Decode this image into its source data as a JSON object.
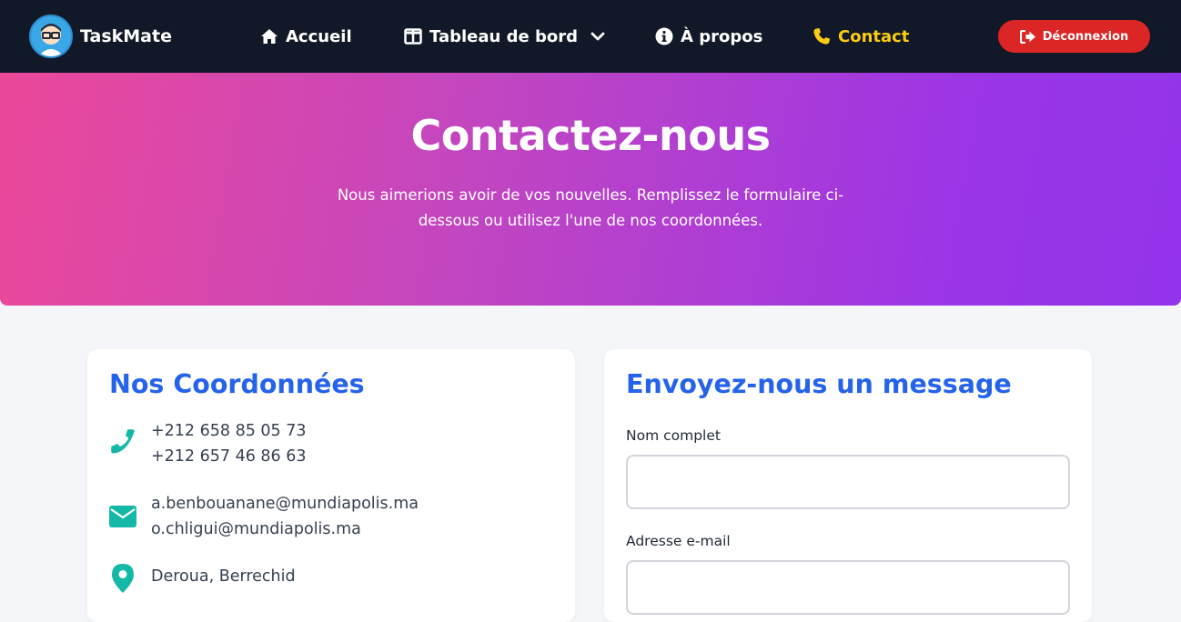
{
  "brand": {
    "name": "TaskMate",
    "logo_icon": "avatar-glasses-icon"
  },
  "nav": {
    "home": "Accueil",
    "dashboard": "Tableau de bord",
    "about": "À propos",
    "contact": "Contact",
    "logout": "Déconnexion",
    "active_color": "#facc15"
  },
  "hero": {
    "title": "Contactez-nous",
    "subtitle": "Nous aimerions avoir de vos nouvelles. Remplissez le formulaire ci-dessous ou utilisez l'une de nos coordonnées."
  },
  "contact_info": {
    "title": "Nos Coordonnées",
    "phones": [
      "+212 658 85 05 73",
      "+212 657 46 86 63"
    ],
    "emails": [
      "a.benbouanane@mundiapolis.ma",
      "o.chligui@mundiapolis.ma"
    ],
    "location": "Deroua, Berrechid",
    "icon_color": "#14b8a6"
  },
  "form": {
    "title": "Envoyez-nous un message",
    "name_label": "Nom complet",
    "name_value": "",
    "email_label": "Adresse e-mail",
    "email_value": ""
  },
  "colors": {
    "navbar": "#111827",
    "accent": "#2563eb",
    "logout": "#dc2626"
  }
}
